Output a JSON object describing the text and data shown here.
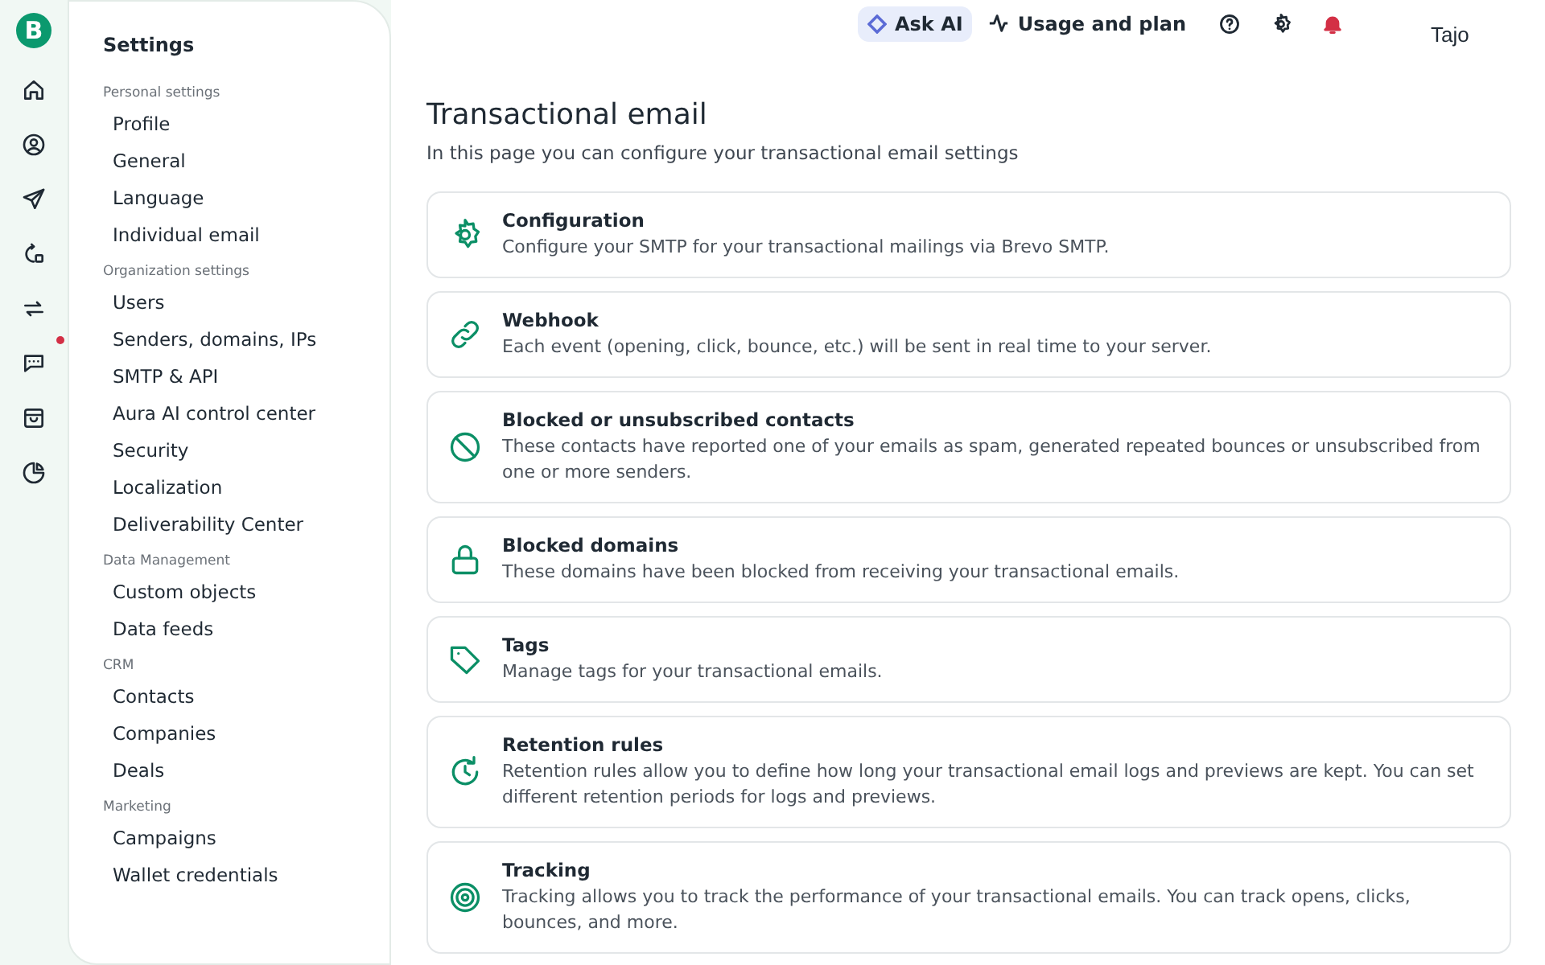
{
  "rail": {
    "logo": "B",
    "icons": [
      {
        "kind": "home",
        "badge": false
      },
      {
        "kind": "contacts",
        "badge": false
      },
      {
        "kind": "send",
        "badge": false
      },
      {
        "kind": "automation",
        "badge": false
      },
      {
        "kind": "sync",
        "badge": false
      },
      {
        "kind": "chat",
        "badge": true
      },
      {
        "kind": "bag",
        "badge": false
      },
      {
        "kind": "chart",
        "badge": false
      }
    ]
  },
  "settings_nav": {
    "title": "Settings",
    "sections": [
      {
        "heading": "Personal settings",
        "items": [
          "Profile",
          "General",
          "Language",
          "Individual email"
        ]
      },
      {
        "heading": "Organization settings",
        "items": [
          "Users",
          "Senders, domains, IPs",
          "SMTP & API",
          "Aura AI control center",
          "Security",
          "Localization",
          "Deliverability Center"
        ]
      },
      {
        "heading": "Data Management",
        "items": [
          "Custom objects",
          "Data feeds"
        ]
      },
      {
        "heading": "CRM",
        "items": [
          "Contacts",
          "Companies",
          "Deals"
        ]
      },
      {
        "heading": "Marketing",
        "items": [
          "Campaigns",
          "Wallet credentials"
        ]
      }
    ]
  },
  "topbar": {
    "ask_ai": "Ask AI",
    "usage": "Usage and plan",
    "notification_alert": true,
    "account": "Tajo"
  },
  "page": {
    "title": "Transactional email",
    "subtitle": "In this page you can configure your transactional email settings"
  },
  "cards": [
    {
      "kind": "gear",
      "title": "Configuration",
      "description": "Configure your SMTP for your transactional mailings via Brevo SMTP."
    },
    {
      "kind": "link",
      "title": "Webhook",
      "description": "Each event (opening, click, bounce, etc.) will be sent in real time to your server."
    },
    {
      "kind": "blocked",
      "title": "Blocked or unsubscribed contacts",
      "description": "These contacts have reported one of your emails as spam, generated repeated bounces or unsubscribed from one or more senders."
    },
    {
      "kind": "lock",
      "title": "Blocked domains",
      "description": "These domains have been blocked from receiving your transactional emails."
    },
    {
      "kind": "tag",
      "title": "Tags",
      "description": "Manage tags for your transactional emails."
    },
    {
      "kind": "retention",
      "title": "Retention rules",
      "description": "Retention rules allow you to define how long your transactional email logs and previews are kept. You can set different retention periods for logs and previews."
    },
    {
      "kind": "target",
      "title": "Tracking",
      "description": "Tracking allows you to track the performance of your transactional emails. You can track opens, clicks, bounces, and more."
    }
  ]
}
